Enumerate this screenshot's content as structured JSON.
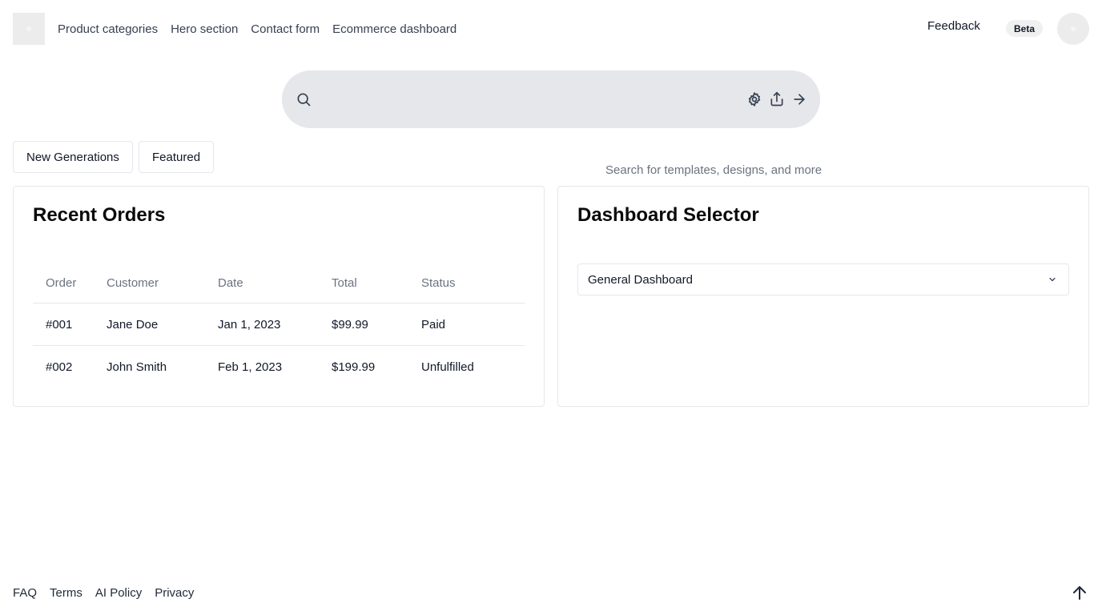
{
  "header": {
    "nav": [
      "Product categories",
      "Hero section",
      "Contact form",
      "Ecommerce dashboard"
    ],
    "feedback": "Feedback",
    "beta": "Beta"
  },
  "search": {
    "placeholder": "Search for templates, designs, and more",
    "icons": [
      "search-icon",
      "settings-icon",
      "upload-icon",
      "arrow-right-icon"
    ]
  },
  "tabs": [
    "New Generations",
    "Featured"
  ],
  "orders": {
    "title": "Recent Orders",
    "columns": [
      "Order",
      "Customer",
      "Date",
      "Total",
      "Status"
    ],
    "rows": [
      [
        "#001",
        "Jane Doe",
        "Jan 1, 2023",
        "$99.99",
        "Paid"
      ],
      [
        "#002",
        "John Smith",
        "Feb 1, 2023",
        "$199.99",
        "Unfulfilled"
      ]
    ]
  },
  "dashboard": {
    "title": "Dashboard Selector",
    "selected": "General Dashboard"
  },
  "footer": {
    "links": [
      "FAQ",
      "Terms",
      "AI Policy",
      "Privacy"
    ]
  }
}
